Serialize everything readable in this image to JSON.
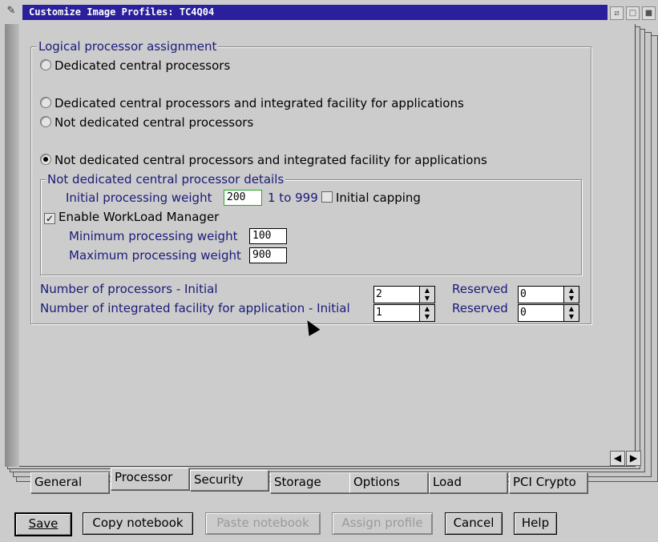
{
  "window": {
    "title": "Customize Image Profiles: TC4Q04"
  },
  "logical_assignment": {
    "title": "Logical processor assignment",
    "options": [
      {
        "label": "Dedicated central processors",
        "selected": false
      },
      {
        "label": "Dedicated central processors and integrated facility for applications",
        "selected": false
      },
      {
        "label": "Not dedicated central processors",
        "selected": false
      },
      {
        "label": "Not dedicated central processors and integrated facility for applications",
        "selected": true
      }
    ]
  },
  "details": {
    "title": "Not dedicated central processor details",
    "initial_weight_label": "Initial processing weight",
    "initial_weight_value": "200",
    "range_text": "1 to 999",
    "initial_capping_label": "Initial capping",
    "initial_capping_checked": false,
    "wlm_label": "Enable WorkLoad Manager",
    "wlm_checked": true,
    "min_weight_label": "Minimum processing weight",
    "min_weight_value": "100",
    "max_weight_label": "Maximum processing weight",
    "max_weight_value": "900"
  },
  "processors": {
    "initial_label": "Number of processors - Initial",
    "initial_value": "2",
    "reserved_label": "Reserved",
    "reserved_value": "0",
    "ifa_label": "Number of integrated facility for application - Initial",
    "ifa_value": "1",
    "ifa_reserved_label": "Reserved",
    "ifa_reserved_value": "0"
  },
  "tabs": [
    "General",
    "Processor",
    "Security",
    "Storage",
    "Options",
    "Load",
    "PCI Crypto"
  ],
  "active_tab": "Processor",
  "buttons": {
    "save": "Save",
    "copy": "Copy notebook",
    "paste": "Paste notebook",
    "assign": "Assign profile",
    "cancel": "Cancel",
    "help": "Help"
  },
  "icons": {
    "sysmenu": "pencil-icon",
    "prev": "arrow-left-icon",
    "next": "arrow-right-icon"
  }
}
